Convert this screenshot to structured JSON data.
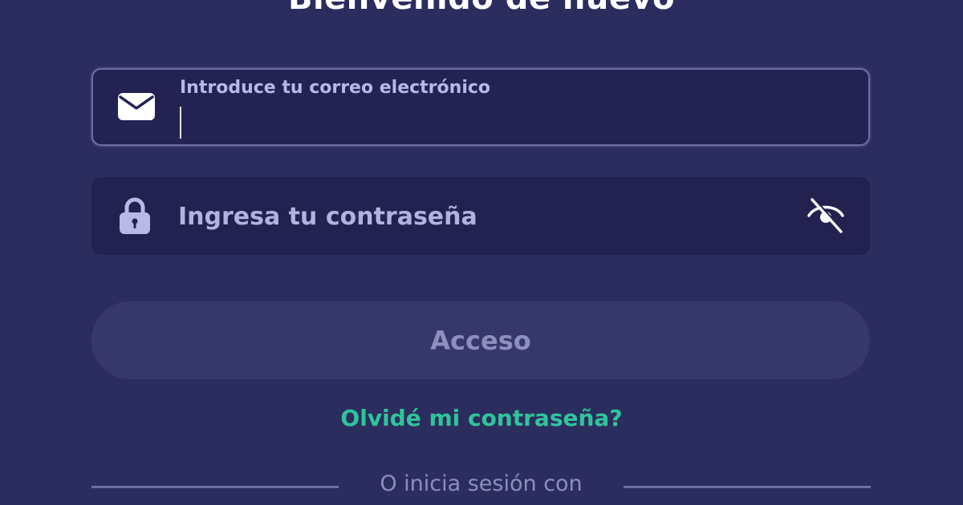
{
  "header": {
    "title": "Bienvenido de nuevo"
  },
  "email": {
    "label": "Introduce tu correo electrónico",
    "value": "",
    "icon": "envelope-icon"
  },
  "password": {
    "placeholder": "Ingresa tu contraseña",
    "value": "",
    "icon": "lock-icon",
    "toggle_icon": "eye-off-icon"
  },
  "actions": {
    "login_label": "Acceso",
    "forgot_label": "Olvidé mi contraseña?",
    "divider_label": "O inicia sesión con"
  },
  "colors": {
    "background": "#2c2d5f",
    "field_background": "#222150",
    "accent": "#2ec59a",
    "button_disabled": "#36376b"
  }
}
